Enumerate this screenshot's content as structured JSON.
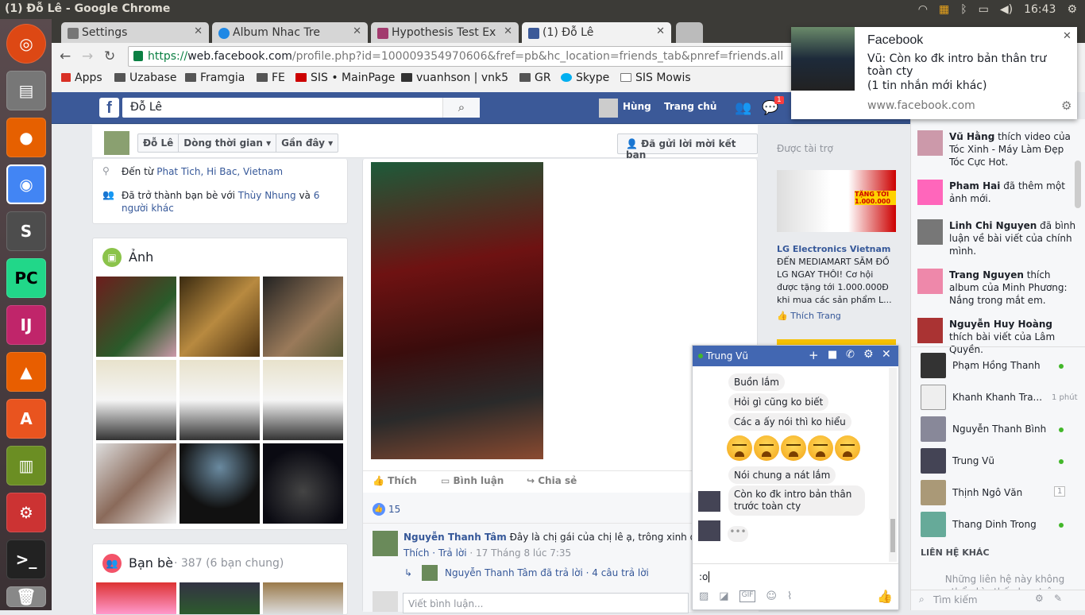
{
  "window": {
    "title": "(1) Đỗ Lê - Google Chrome",
    "clock": "16:43"
  },
  "tabs": [
    {
      "label": "Settings"
    },
    {
      "label": "Album Nhac Tre"
    },
    {
      "label": "Hypothesis Test Ex"
    },
    {
      "label": "(1) Đỗ Lê"
    }
  ],
  "url": {
    "scheme": "https://",
    "host": "web.facebook.com",
    "path": "/profile.php?id=100009354970606&fref=pb&hc_location=friends_tab&pnref=friends.all"
  },
  "bookmarks": [
    "Apps",
    "Uzabase",
    "Framgia",
    "FE",
    "SIS • MainPage",
    "vuanhson | vnk5",
    "GR",
    "Skype",
    "SIS Mowis"
  ],
  "fb": {
    "search_value": "Đỗ Lê",
    "user_name": "Hùng",
    "home_label": "Trang chủ",
    "notif_count": "1",
    "profile_name_btn": "Đỗ Lê",
    "timeline_btn": "Dòng thời gian",
    "recent_btn": "Gần đây",
    "friend_req_btn": "Đã gửi lời mời kết bạn",
    "from_prefix": "Đến từ ",
    "from_place": "Phat Tich, Hi Bac, Vietnam",
    "friends_prefix": "Đã trở thành bạn bè với ",
    "friends_link": "Thùy Nhung",
    "friends_and": " và ",
    "friends_others": "6 người khác",
    "photos_title": "Ảnh",
    "friends_title": "Bạn bè",
    "friends_count": "· 387 (6 bạn chung)",
    "like_label": "Thích",
    "comment_label": "Bình luận",
    "share_label": "Chia sẻ",
    "likes_count": "15",
    "comment": {
      "author": "Nguyễn Thanh Tâm",
      "text": "Đây là chị gái của chị lê ạ, trông xinh quá 🙂",
      "actions": "Thích · Trả lời",
      "time": " · 17 Tháng 8 lúc 7:35"
    },
    "reply_summary": "Nguyễn Thanh Tâm đã trả lời · 4 câu trả lời",
    "comment_placeholder": "Viết bình luận...",
    "sponsored": "Được tài trợ",
    "ad": {
      "advertiser": "LG Electronics Vietnam",
      "text": "ĐẾN MEDIAMART SĂM ĐỒ LG NGAY THÔI! Cơ hội được tặng tới 1.000.000Đ khi mua các sản phẩm L...",
      "like": "Thích Trang",
      "banner_text": "TẶNG TỚI 1.000.000"
    }
  },
  "notification": {
    "app": "Facebook",
    "body": "Vũ: Còn ko đk intro bản thân trư toàn cty",
    "extra": "(1 tin nhắn mới khác)",
    "site": "www.facebook.com"
  },
  "ticker": [
    {
      "name": "Vũ Hằng",
      "text": " thích video của Tóc Xinh - Máy Làm Đẹp Tóc Cực Hot."
    },
    {
      "name": "Pham Hai",
      "text": " đã thêm một ảnh mới."
    },
    {
      "name": "Linh Chi Nguyen",
      "text": " đã bình luận về bài viết của chính mình."
    },
    {
      "name": "Trang Nguyen",
      "text": " thích album của Minh Phương: Nắng trong mắt em."
    },
    {
      "name": "Nguyễn Huy Hoàng",
      "text": " thích bài viết của Lâm Quyền."
    }
  ],
  "contacts": [
    {
      "name": "Phạm Hồng Thanh",
      "status": ""
    },
    {
      "name": "Khanh Khanh Tra...",
      "status": "1 phút"
    },
    {
      "name": "Nguyễn Thanh Bình",
      "status": ""
    },
    {
      "name": "Trung Vũ",
      "status": ""
    },
    {
      "name": "Thịnh Ngô Văn",
      "status": "1"
    },
    {
      "name": "Thang Dinh Trong",
      "status": ""
    }
  ],
  "other_contacts": "LIÊN HỆ KHÁC",
  "other_contacts_note": "Những liên hệ này không thể nhìn thấy bạn trên",
  "sidebar_search": "Tìm kiếm",
  "chat": {
    "name": "Trung Vũ",
    "messages": [
      "Buồn lắm",
      "Hỏi gì cũng ko biết",
      "Các a ấy nói thì ko hiểu",
      "Nói chung a nát lắm",
      "Còn ko đk intro bản thân trước toàn cty"
    ],
    "input_value": ":o"
  },
  "colors": {
    "fb_blue": "#3b5998",
    "link": "#365899",
    "online": "#42b72a"
  }
}
